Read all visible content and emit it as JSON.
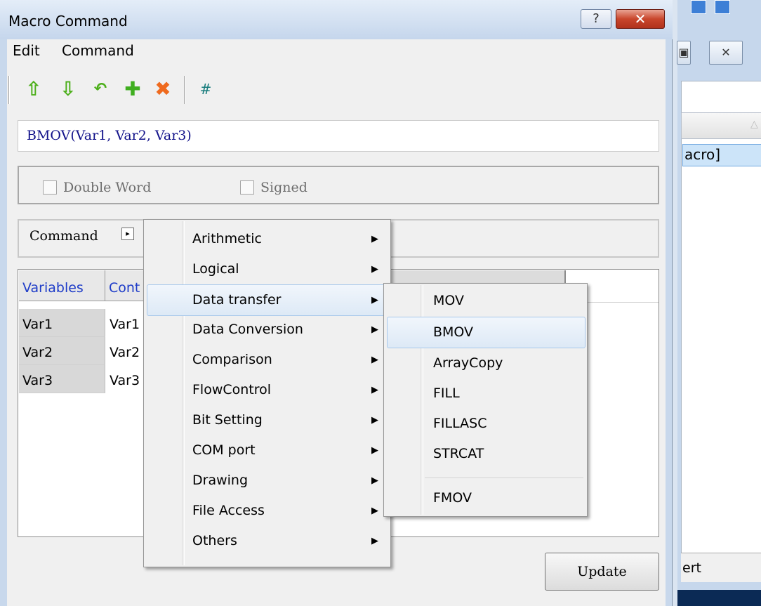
{
  "dialog": {
    "title": "Macro Command",
    "help_label": "?",
    "close_label": "✕"
  },
  "menubar": {
    "items": [
      "Edit",
      "Command"
    ]
  },
  "toolbar": {
    "move_up_icon": "⇧",
    "move_down_icon": "⇩",
    "replace_icon": "↶",
    "add_icon": "✚",
    "delete_icon": "✖",
    "number_icon": "#"
  },
  "command_text": "BMOV(Var1, Var2, Var3)",
  "options": {
    "double_word": "Double Word",
    "signed": "Signed"
  },
  "command_selector": {
    "label": "Command",
    "arrow": "▸"
  },
  "grid": {
    "headers": [
      "Variables",
      "Cont"
    ],
    "rows": [
      {
        "var": "Var1",
        "content": "Var1"
      },
      {
        "var": "Var2",
        "content": "Var2"
      },
      {
        "var": "Var3",
        "content": "Var3"
      }
    ]
  },
  "update_label": "Update",
  "context_menu": {
    "items": [
      "Arithmetic",
      "Logical",
      "Data transfer",
      "Data Conversion",
      "Comparison",
      "FlowControl",
      "Bit Setting",
      "COM port",
      "Drawing",
      "File Access",
      "Others"
    ],
    "highlighted": "Data transfer",
    "arrow": "▶"
  },
  "submenu": {
    "items": [
      "MOV",
      "BMOV",
      "ArrayCopy",
      "FILL",
      "FILLASC",
      "STRCAT",
      "FMOV"
    ],
    "highlighted": "BMOV"
  },
  "background_window": {
    "selected_text": "acro]",
    "status_text": "ert",
    "restore_label": "▣",
    "close_label": "✕",
    "sort_arrow": "△"
  },
  "colors": {
    "accent": "#1e3cc8",
    "close": "#c9462c",
    "highlight": "#dde9f6"
  }
}
